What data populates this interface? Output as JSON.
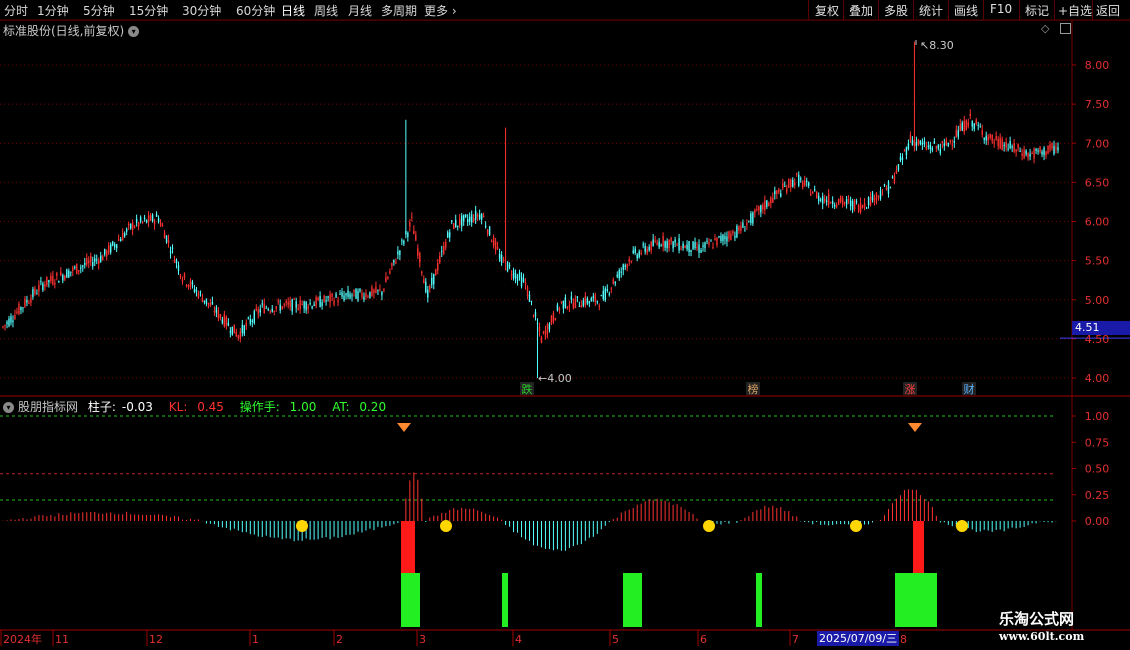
{
  "toolbar": {
    "periods": [
      {
        "label": "分时",
        "active": false
      },
      {
        "label": "1分钟",
        "active": false
      },
      {
        "label": "5分钟",
        "active": false
      },
      {
        "label": "15分钟",
        "active": false
      },
      {
        "label": "30分钟",
        "active": false
      },
      {
        "label": "60分钟",
        "active": false
      },
      {
        "label": "日线",
        "active": true
      },
      {
        "label": "周线",
        "active": false
      },
      {
        "label": "月线",
        "active": false
      },
      {
        "label": "多周期",
        "active": false
      },
      {
        "label": "更多",
        "active": false
      }
    ],
    "actions": [
      "复权",
      "叠加",
      "多股",
      "统计",
      "画线",
      "F10",
      "标记",
      "+自选",
      "返回"
    ]
  },
  "main_chart": {
    "title": "标准股份(日线,前复权)",
    "y_ticks": [
      "8.00",
      "7.50",
      "7.00",
      "6.50",
      "6.00",
      "5.50",
      "5.00",
      "4.50",
      "4.00"
    ],
    "current_price": "4.51",
    "high_label": "8.30",
    "low_label": "4.00",
    "event_tags": [
      {
        "text": "跌",
        "color": "#2ad02a"
      },
      {
        "text": "榜",
        "color": "#d4a060"
      },
      {
        "text": "涨",
        "color": "#ff4040"
      },
      {
        "text": "财",
        "color": "#5ab4ff"
      }
    ]
  },
  "indicator": {
    "name": "股朋指标网",
    "columns": {
      "label": "柱子:",
      "value": "-0.03"
    },
    "kl": {
      "label": "KL:",
      "value": "0.45",
      "color": "#ff3030"
    },
    "op": {
      "label": "操作手:",
      "value": "1.00",
      "color": "#30ff30"
    },
    "at": {
      "label": "AT:",
      "value": "0.20",
      "color": "#30ff30"
    },
    "y_ticks": [
      "1.00",
      "0.75",
      "0.50",
      "0.25",
      "0.00"
    ]
  },
  "time_axis": {
    "labels": [
      "2024年",
      "11",
      "12",
      "1",
      "2",
      "3",
      "4",
      "5",
      "6",
      "7",
      "8"
    ],
    "cursor_date": "2025/07/09/三"
  },
  "watermark": {
    "title": "乐淘公式网",
    "url": "www.60lt.com"
  },
  "colors": {
    "up": "#ff3232",
    "down": "#54ffff",
    "grid": "#7a0000",
    "bg": "#000000"
  }
}
